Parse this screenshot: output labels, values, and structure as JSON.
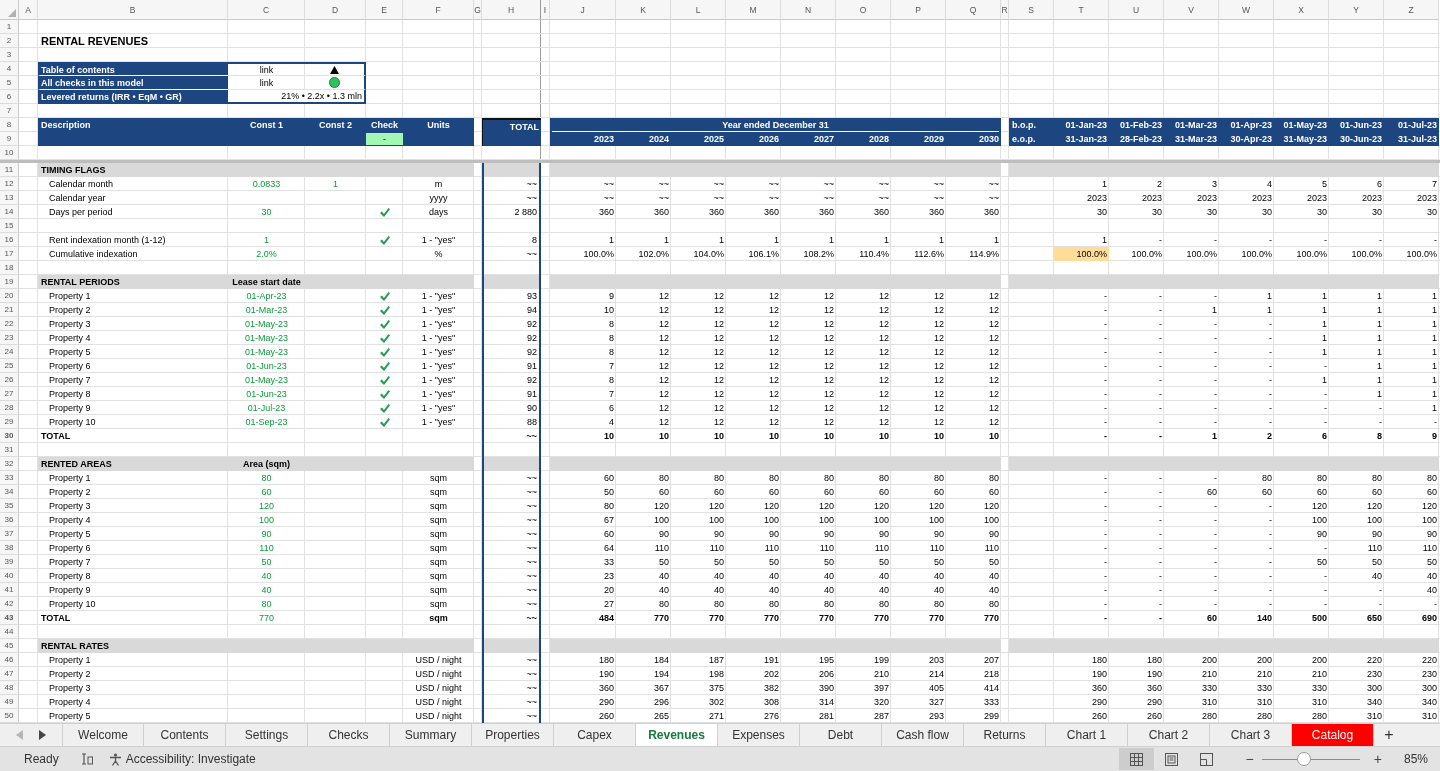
{
  "column_letters": [
    "A",
    "B",
    "C",
    "D",
    "E",
    "F",
    "G",
    "H",
    "I",
    "J",
    "K",
    "L",
    "M",
    "N",
    "O",
    "P",
    "Q",
    "R",
    "S",
    "T",
    "U",
    "V",
    "W",
    "X",
    "Y",
    "Z"
  ],
  "row_numbers": [
    "1",
    "2",
    "3",
    "4",
    "5",
    "6",
    "7",
    "8",
    "9",
    "10",
    "11",
    "12",
    "13",
    "14",
    "15",
    "16",
    "17",
    "18",
    "19",
    "20",
    "21",
    "22",
    "23",
    "24",
    "25",
    "26",
    "27",
    "28",
    "29",
    "30",
    "31",
    "32",
    "33",
    "34",
    "35",
    "36",
    "37",
    "38",
    "39",
    "40",
    "41",
    "42",
    "43",
    "44",
    "45",
    "46",
    "47",
    "48",
    "49",
    "50"
  ],
  "title": "RENTAL REVENUES",
  "summary": [
    {
      "kind": "contents_link",
      "label": "Table of contents",
      "value": "link"
    },
    {
      "kind": "checks_link",
      "label": "All checks in this model",
      "value": "link",
      "checks_ok": true
    },
    {
      "kind": "returns",
      "label": "Levered returns (IRR • EqM • GR)",
      "value": "21% • 2.2x • 1.3 mln"
    }
  ],
  "header": {
    "description": "Description",
    "const_1": "Const 1",
    "const_2": "Const 2",
    "check": "Check",
    "check_value": "-",
    "check_ok": true,
    "units": "Units",
    "total": "TOTAL",
    "period": "Year ended December 31",
    "years": [
      "2023",
      "2024",
      "2025",
      "2026",
      "2027",
      "2028",
      "2029",
      "2030"
    ],
    "bop": "b.o.p.",
    "bop_dates": [
      "01-Jan-23",
      "01-Feb-23",
      "01-Mar-23",
      "01-Apr-23",
      "01-May-23",
      "01-Jun-23",
      "01-Jul-23"
    ],
    "eop": "e.o.p.",
    "eop_dates": [
      "31-Jan-23",
      "28-Feb-23",
      "31-Mar-23",
      "30-Apr-23",
      "31-May-23",
      "30-Jun-23",
      "31-Jul-23"
    ]
  },
  "rows": [
    {
      "kind": "section",
      "label": "TIMING FLAGS"
    },
    {
      "kind": "item",
      "label": "Calendar month",
      "const_1": "0.0833",
      "const_2": "1",
      "units": "m",
      "total": "~~",
      "annual": [
        "~~",
        "~~",
        "~~",
        "~~",
        "~~",
        "~~",
        "~~",
        "~~"
      ],
      "monthly": [
        "1",
        "2",
        "3",
        "4",
        "5",
        "6",
        "7"
      ]
    },
    {
      "kind": "item",
      "label": "Calendar year",
      "units": "yyyy",
      "total": "~~",
      "annual": [
        "~~",
        "~~",
        "~~",
        "~~",
        "~~",
        "~~",
        "~~",
        "~~"
      ],
      "monthly": [
        "2023",
        "2023",
        "2023",
        "2023",
        "2023",
        "2023",
        "2023"
      ]
    },
    {
      "kind": "item",
      "label": "Days per period",
      "const_1": "30",
      "check": true,
      "units": "days",
      "total": "2 880",
      "annual": [
        "360",
        "360",
        "360",
        "360",
        "360",
        "360",
        "360",
        "360"
      ],
      "monthly": [
        "30",
        "30",
        "30",
        "30",
        "30",
        "30",
        "30"
      ]
    },
    {
      "kind": "blank"
    },
    {
      "kind": "item",
      "label": "Rent indexation month (1-12)",
      "const_1": "1",
      "check": true,
      "units": "1 - \"yes\"",
      "total": "8",
      "annual": [
        "1",
        "1",
        "1",
        "1",
        "1",
        "1",
        "1",
        "1"
      ],
      "monthly": [
        "1",
        "-",
        "-",
        "-",
        "-",
        "-",
        "-"
      ]
    },
    {
      "kind": "item",
      "label": "Cumulative indexation",
      "const_1": "2.0%",
      "units": "%",
      "total": "~~",
      "annual": [
        "100.0%",
        "102.0%",
        "104.0%",
        "106.1%",
        "108.2%",
        "110.4%",
        "112.6%",
        "114.9%"
      ],
      "monthly": [
        "100.0%",
        "100.0%",
        "100.0%",
        "100.0%",
        "100.0%",
        "100.0%",
        "100.0%"
      ],
      "monthly_highlighted": [
        true,
        false,
        false,
        false,
        false,
        false,
        false
      ]
    },
    {
      "kind": "blank"
    },
    {
      "kind": "section",
      "label": "RENTAL PERIODS",
      "subheading": "Lease start date"
    },
    {
      "kind": "item",
      "label": "Property 1",
      "const_1": "01-Apr-23",
      "check": true,
      "units": "1 - \"yes\"",
      "total": "93",
      "annual": [
        "9",
        "12",
        "12",
        "12",
        "12",
        "12",
        "12",
        "12"
      ],
      "monthly": [
        "-",
        "-",
        "-",
        "1",
        "1",
        "1",
        "1"
      ]
    },
    {
      "kind": "item",
      "label": "Property 2",
      "const_1": "01-Mar-23",
      "check": true,
      "units": "1 - \"yes\"",
      "total": "94",
      "annual": [
        "10",
        "12",
        "12",
        "12",
        "12",
        "12",
        "12",
        "12"
      ],
      "monthly": [
        "-",
        "-",
        "1",
        "1",
        "1",
        "1",
        "1"
      ]
    },
    {
      "kind": "item",
      "label": "Property 3",
      "const_1": "01-May-23",
      "check": true,
      "units": "1 - \"yes\"",
      "total": "92",
      "annual": [
        "8",
        "12",
        "12",
        "12",
        "12",
        "12",
        "12",
        "12"
      ],
      "monthly": [
        "-",
        "-",
        "-",
        "-",
        "1",
        "1",
        "1"
      ]
    },
    {
      "kind": "item",
      "label": "Property 4",
      "const_1": "01-May-23",
      "check": true,
      "units": "1 - \"yes\"",
      "total": "92",
      "annual": [
        "8",
        "12",
        "12",
        "12",
        "12",
        "12",
        "12",
        "12"
      ],
      "monthly": [
        "-",
        "-",
        "-",
        "-",
        "1",
        "1",
        "1"
      ]
    },
    {
      "kind": "item",
      "label": "Property 5",
      "const_1": "01-May-23",
      "check": true,
      "units": "1 - \"yes\"",
      "total": "92",
      "annual": [
        "8",
        "12",
        "12",
        "12",
        "12",
        "12",
        "12",
        "12"
      ],
      "monthly": [
        "-",
        "-",
        "-",
        "-",
        "1",
        "1",
        "1"
      ]
    },
    {
      "kind": "item",
      "label": "Property 6",
      "const_1": "01-Jun-23",
      "check": true,
      "units": "1 - \"yes\"",
      "total": "91",
      "annual": [
        "7",
        "12",
        "12",
        "12",
        "12",
        "12",
        "12",
        "12"
      ],
      "monthly": [
        "-",
        "-",
        "-",
        "-",
        "-",
        "1",
        "1"
      ]
    },
    {
      "kind": "item",
      "label": "Property 7",
      "const_1": "01-May-23",
      "check": true,
      "units": "1 - \"yes\"",
      "total": "92",
      "annual": [
        "8",
        "12",
        "12",
        "12",
        "12",
        "12",
        "12",
        "12"
      ],
      "monthly": [
        "-",
        "-",
        "-",
        "-",
        "1",
        "1",
        "1"
      ]
    },
    {
      "kind": "item",
      "label": "Property 8",
      "const_1": "01-Jun-23",
      "check": true,
      "units": "1 - \"yes\"",
      "total": "91",
      "annual": [
        "7",
        "12",
        "12",
        "12",
        "12",
        "12",
        "12",
        "12"
      ],
      "monthly": [
        "-",
        "-",
        "-",
        "-",
        "-",
        "1",
        "1"
      ]
    },
    {
      "kind": "item",
      "label": "Property 9",
      "const_1": "01-Jul-23",
      "check": true,
      "units": "1 - \"yes\"",
      "total": "90",
      "annual": [
        "6",
        "12",
        "12",
        "12",
        "12",
        "12",
        "12",
        "12"
      ],
      "monthly": [
        "-",
        "-",
        "-",
        "-",
        "-",
        "-",
        "1"
      ]
    },
    {
      "kind": "item",
      "label": "Property 10",
      "const_1": "01-Sep-23",
      "check": true,
      "units": "1 - \"yes\"",
      "total": "88",
      "annual": [
        "4",
        "12",
        "12",
        "12",
        "12",
        "12",
        "12",
        "12"
      ],
      "monthly": [
        "-",
        "-",
        "-",
        "-",
        "-",
        "-",
        "-"
      ]
    },
    {
      "kind": "total",
      "label": "TOTAL",
      "total": "~~",
      "annual": [
        "10",
        "10",
        "10",
        "10",
        "10",
        "10",
        "10",
        "10"
      ],
      "monthly": [
        "-",
        "-",
        "1",
        "2",
        "6",
        "8",
        "9"
      ]
    },
    {
      "kind": "blank"
    },
    {
      "kind": "section",
      "label": "RENTED AREAS",
      "subheading": "Area (sqm)"
    },
    {
      "kind": "item",
      "label": "Property 1",
      "const_1": "80",
      "units": "sqm",
      "total": "~~",
      "annual": [
        "60",
        "80",
        "80",
        "80",
        "80",
        "80",
        "80",
        "80"
      ],
      "monthly": [
        "-",
        "-",
        "-",
        "80",
        "80",
        "80",
        "80"
      ]
    },
    {
      "kind": "item",
      "label": "Property 2",
      "const_1": "60",
      "units": "sqm",
      "total": "~~",
      "annual": [
        "50",
        "60",
        "60",
        "60",
        "60",
        "60",
        "60",
        "60"
      ],
      "monthly": [
        "-",
        "-",
        "60",
        "60",
        "60",
        "60",
        "60"
      ]
    },
    {
      "kind": "item",
      "label": "Property 3",
      "const_1": "120",
      "units": "sqm",
      "total": "~~",
      "annual": [
        "80",
        "120",
        "120",
        "120",
        "120",
        "120",
        "120",
        "120"
      ],
      "monthly": [
        "-",
        "-",
        "-",
        "-",
        "120",
        "120",
        "120"
      ]
    },
    {
      "kind": "item",
      "label": "Property 4",
      "const_1": "100",
      "units": "sqm",
      "total": "~~",
      "annual": [
        "67",
        "100",
        "100",
        "100",
        "100",
        "100",
        "100",
        "100"
      ],
      "monthly": [
        "-",
        "-",
        "-",
        "-",
        "100",
        "100",
        "100"
      ]
    },
    {
      "kind": "item",
      "label": "Property 5",
      "const_1": "90",
      "units": "sqm",
      "total": "~~",
      "annual": [
        "60",
        "90",
        "90",
        "90",
        "90",
        "90",
        "90",
        "90"
      ],
      "monthly": [
        "-",
        "-",
        "-",
        "-",
        "90",
        "90",
        "90"
      ]
    },
    {
      "kind": "item",
      "label": "Property 6",
      "const_1": "110",
      "units": "sqm",
      "total": "~~",
      "annual": [
        "64",
        "110",
        "110",
        "110",
        "110",
        "110",
        "110",
        "110"
      ],
      "monthly": [
        "-",
        "-",
        "-",
        "-",
        "-",
        "110",
        "110"
      ]
    },
    {
      "kind": "item",
      "label": "Property 7",
      "const_1": "50",
      "units": "sqm",
      "total": "~~",
      "annual": [
        "33",
        "50",
        "50",
        "50",
        "50",
        "50",
        "50",
        "50"
      ],
      "monthly": [
        "-",
        "-",
        "-",
        "-",
        "50",
        "50",
        "50"
      ]
    },
    {
      "kind": "item",
      "label": "Property 8",
      "const_1": "40",
      "units": "sqm",
      "total": "~~",
      "annual": [
        "23",
        "40",
        "40",
        "40",
        "40",
        "40",
        "40",
        "40"
      ],
      "monthly": [
        "-",
        "-",
        "-",
        "-",
        "-",
        "40",
        "40"
      ]
    },
    {
      "kind": "item",
      "label": "Property 9",
      "const_1": "40",
      "units": "sqm",
      "total": "~~",
      "annual": [
        "20",
        "40",
        "40",
        "40",
        "40",
        "40",
        "40",
        "40"
      ],
      "monthly": [
        "-",
        "-",
        "-",
        "-",
        "-",
        "-",
        "40"
      ]
    },
    {
      "kind": "item",
      "label": "Property 10",
      "const_1": "80",
      "units": "sqm",
      "total": "~~",
      "annual": [
        "27",
        "80",
        "80",
        "80",
        "80",
        "80",
        "80",
        "80"
      ],
      "monthly": [
        "-",
        "-",
        "-",
        "-",
        "-",
        "-",
        "-"
      ]
    },
    {
      "kind": "total",
      "label": "TOTAL",
      "const_1": "770",
      "units": "sqm",
      "total": "~~",
      "annual": [
        "484",
        "770",
        "770",
        "770",
        "770",
        "770",
        "770",
        "770"
      ],
      "monthly": [
        "-",
        "-",
        "60",
        "140",
        "500",
        "650",
        "690"
      ]
    },
    {
      "kind": "blank"
    },
    {
      "kind": "section",
      "label": "RENTAL RATES"
    },
    {
      "kind": "item",
      "label": "Property 1",
      "units": "USD / night",
      "total": "~~",
      "annual": [
        "180",
        "184",
        "187",
        "191",
        "195",
        "199",
        "203",
        "207"
      ],
      "monthly": [
        "180",
        "180",
        "200",
        "200",
        "200",
        "220",
        "220"
      ]
    },
    {
      "kind": "item",
      "label": "Property 2",
      "units": "USD / night",
      "total": "~~",
      "annual": [
        "190",
        "194",
        "198",
        "202",
        "206",
        "210",
        "214",
        "218"
      ],
      "monthly": [
        "190",
        "190",
        "210",
        "210",
        "210",
        "230",
        "230"
      ]
    },
    {
      "kind": "item",
      "label": "Property 3",
      "units": "USD / night",
      "total": "~~",
      "annual": [
        "360",
        "367",
        "375",
        "382",
        "390",
        "397",
        "405",
        "414"
      ],
      "monthly": [
        "360",
        "360",
        "330",
        "330",
        "330",
        "300",
        "300"
      ]
    },
    {
      "kind": "item",
      "label": "Property 4",
      "units": "USD / night",
      "total": "~~",
      "annual": [
        "290",
        "296",
        "302",
        "308",
        "314",
        "320",
        "327",
        "333"
      ],
      "monthly": [
        "290",
        "290",
        "310",
        "310",
        "310",
        "340",
        "340"
      ]
    },
    {
      "kind": "item",
      "label": "Property 5",
      "units": "USD / night",
      "total": "~~",
      "annual": [
        "260",
        "265",
        "271",
        "276",
        "281",
        "287",
        "293",
        "299"
      ],
      "monthly": [
        "260",
        "260",
        "280",
        "280",
        "280",
        "310",
        "310"
      ]
    }
  ],
  "sheet_tabs": {
    "nav_buttons": [
      {
        "kind": "left",
        "disabled": true
      },
      {
        "kind": "right",
        "disabled": false
      }
    ],
    "tabs": [
      {
        "label": "Welcome",
        "selected": false
      },
      {
        "label": "Contents",
        "selected": false
      },
      {
        "label": "Settings",
        "selected": false
      },
      {
        "label": "Checks",
        "selected": false
      },
      {
        "label": "Summary",
        "selected": false
      },
      {
        "label": "Properties",
        "selected": false
      },
      {
        "label": "Capex",
        "selected": false
      },
      {
        "label": "Revenues",
        "selected": true
      },
      {
        "label": "Expenses",
        "selected": false
      },
      {
        "label": "Debt",
        "selected": false
      },
      {
        "label": "Cash flow",
        "selected": false
      },
      {
        "label": "Returns",
        "selected": false
      },
      {
        "label": "Chart 1",
        "selected": false
      },
      {
        "label": "Chart 2",
        "selected": false
      },
      {
        "label": "Chart 3",
        "selected": false
      },
      {
        "label": "Catalog",
        "selected": false,
        "color": "#ff0000"
      }
    ],
    "add_sheet": "+"
  },
  "status_bar": {
    "status": "Ready",
    "accessibility": "Accessibility: Investigate",
    "views": [
      {
        "kind": "normal",
        "selected": true
      },
      {
        "kind": "page_layout",
        "selected": false
      },
      {
        "kind": "page_break",
        "selected": false
      }
    ],
    "zoom": {
      "out": "−",
      "in": "+",
      "level": 0.43,
      "reading": "85%"
    }
  }
}
